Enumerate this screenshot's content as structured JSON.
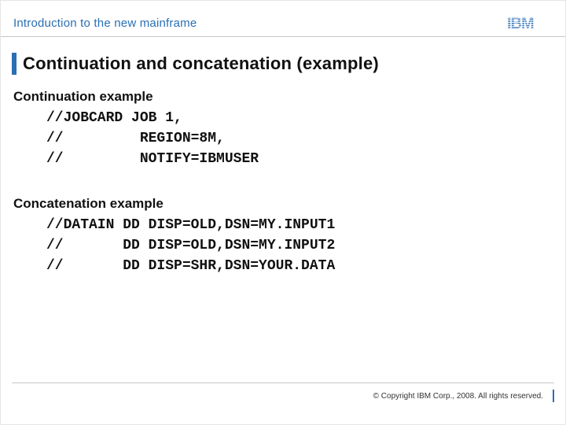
{
  "header": {
    "course_title": "Introduction to the new mainframe",
    "logo_text": "IBM"
  },
  "title": "Continuation and concatenation (example)",
  "sections": {
    "continuation": {
      "heading": "Continuation example",
      "code": "//JOBCARD JOB 1,\n//         REGION=8M,\n//         NOTIFY=IBMUSER"
    },
    "concatenation": {
      "heading": "Concatenation example",
      "code": "//DATAIN DD DISP=OLD,DSN=MY.INPUT1\n//       DD DISP=OLD,DSN=MY.INPUT2\n//       DD DISP=SHR,DSN=YOUR.DATA"
    }
  },
  "footer": {
    "copyright": "© Copyright IBM Corp., 2008. All rights reserved."
  }
}
